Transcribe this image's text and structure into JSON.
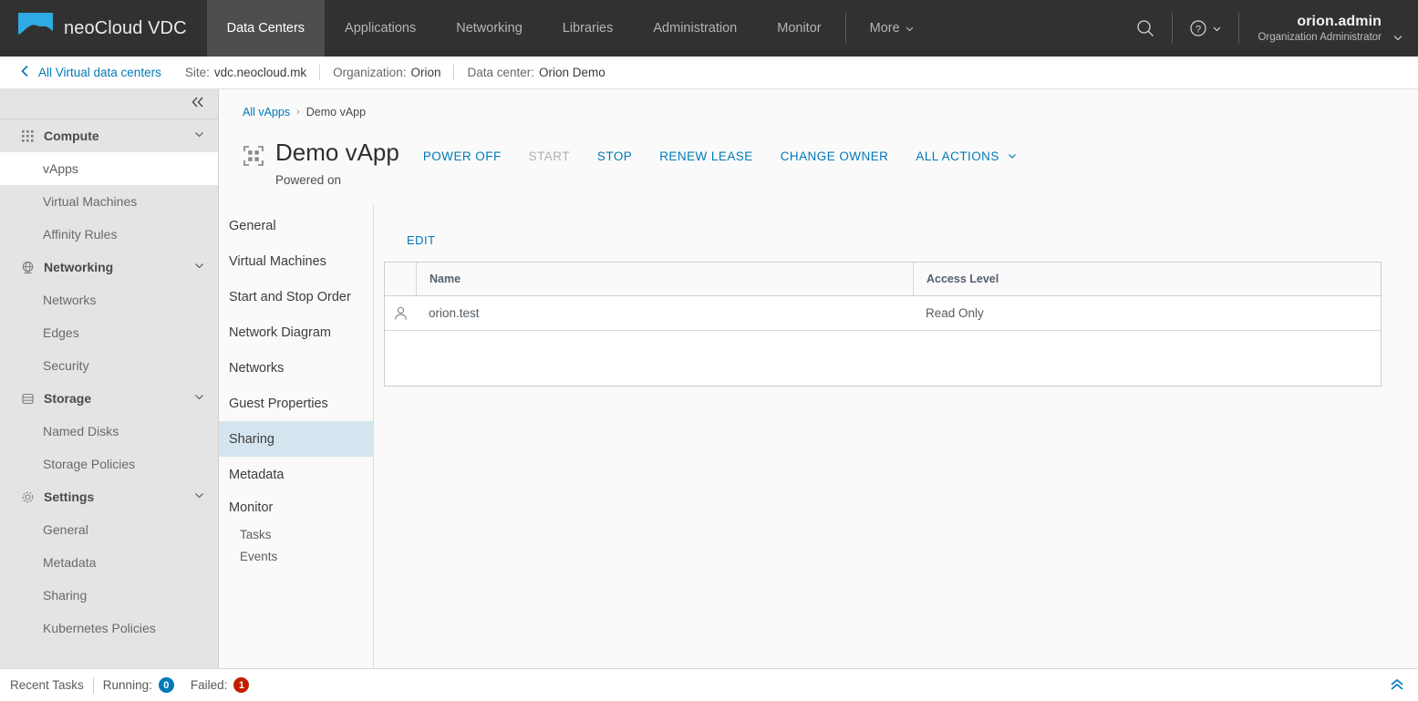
{
  "header": {
    "brand": "neoCloud VDC",
    "logo_icon": "cloud-logo-icon",
    "nav": [
      {
        "label": "Data Centers",
        "active": true
      },
      {
        "label": "Applications",
        "active": false
      },
      {
        "label": "Networking",
        "active": false
      },
      {
        "label": "Libraries",
        "active": false
      },
      {
        "label": "Administration",
        "active": false
      },
      {
        "label": "Monitor",
        "active": false
      }
    ],
    "more_label": "More",
    "search_icon": "search-icon",
    "help_icon": "help-icon",
    "user_name": "orion.admin",
    "user_role": "Organization Administrator"
  },
  "breadcrumb_bar": {
    "back_label": "All Virtual data centers",
    "segments": [
      {
        "label": "Site:",
        "value": "vdc.neocloud.mk"
      },
      {
        "label": "Organization:",
        "value": "Orion"
      },
      {
        "label": "Data center:",
        "value": "Orion Demo"
      }
    ]
  },
  "sidebar": {
    "collapse_icon": "collapse-left-icon",
    "groups": [
      {
        "label": "Compute",
        "icon": "grid-dots-icon",
        "items": [
          {
            "label": "vApps",
            "active": true
          },
          {
            "label": "Virtual Machines",
            "active": false
          },
          {
            "label": "Affinity Rules",
            "active": false
          }
        ]
      },
      {
        "label": "Networking",
        "icon": "globe-icon",
        "items": [
          {
            "label": "Networks",
            "active": false
          },
          {
            "label": "Edges",
            "active": false
          },
          {
            "label": "Security",
            "active": false
          }
        ]
      },
      {
        "label": "Storage",
        "icon": "database-icon",
        "items": [
          {
            "label": "Named Disks",
            "active": false
          },
          {
            "label": "Storage Policies",
            "active": false
          }
        ]
      },
      {
        "label": "Settings",
        "icon": "gear-icon",
        "items": [
          {
            "label": "General",
            "active": false
          },
          {
            "label": "Metadata",
            "active": false
          },
          {
            "label": "Sharing",
            "active": false
          },
          {
            "label": "Kubernetes Policies",
            "active": false
          }
        ]
      }
    ]
  },
  "main": {
    "breadcrumb": {
      "root": "All vApps",
      "separator": "›",
      "current": "Demo vApp"
    },
    "vapp_icon": "vapp-icon",
    "title": "Demo vApp",
    "status": "Powered on",
    "actions": [
      {
        "label": "POWER OFF",
        "disabled": false,
        "caret": false
      },
      {
        "label": "START",
        "disabled": true,
        "caret": false
      },
      {
        "label": "STOP",
        "disabled": false,
        "caret": false
      },
      {
        "label": "RENEW LEASE",
        "disabled": false,
        "caret": false
      },
      {
        "label": "CHANGE OWNER",
        "disabled": false,
        "caret": false
      },
      {
        "label": "ALL ACTIONS",
        "disabled": false,
        "caret": true
      }
    ],
    "inner_nav": [
      {
        "label": "General",
        "active": false,
        "sub": false
      },
      {
        "label": "Virtual Machines",
        "active": false,
        "sub": false
      },
      {
        "label": "Start and Stop Order",
        "active": false,
        "sub": false
      },
      {
        "label": "Network Diagram",
        "active": false,
        "sub": false
      },
      {
        "label": "Networks",
        "active": false,
        "sub": false
      },
      {
        "label": "Guest Properties",
        "active": false,
        "sub": false
      },
      {
        "label": "Sharing",
        "active": true,
        "sub": false
      },
      {
        "label": "Metadata",
        "active": false,
        "sub": false
      },
      {
        "label": "Monitor",
        "active": false,
        "sub": false,
        "parent": true
      },
      {
        "label": "Tasks",
        "active": false,
        "sub": true
      },
      {
        "label": "Events",
        "active": false,
        "sub": true
      }
    ],
    "panel": {
      "edit_label": "EDIT",
      "table": {
        "columns": [
          "",
          "Name",
          "Access Level"
        ],
        "rows": [
          {
            "icon": "user-icon",
            "name": "orion.test",
            "access_level": "Read Only"
          }
        ]
      }
    }
  },
  "footer": {
    "recent_tasks_label": "Recent Tasks",
    "running_label": "Running:",
    "running_count": "0",
    "failed_label": "Failed:",
    "failed_count": "1",
    "expand_icon": "chevron-double-up-icon"
  },
  "colors": {
    "accent": "#0079b8",
    "header_bg": "#313131",
    "nav_active_bg": "#4e4e4e",
    "sidebar_bg": "#e4e4e4",
    "logo_blue": "#2eabe2",
    "badge_running": "#0079b8",
    "badge_failed": "#c21d00",
    "inner_nav_active": "#d5e5ef"
  }
}
